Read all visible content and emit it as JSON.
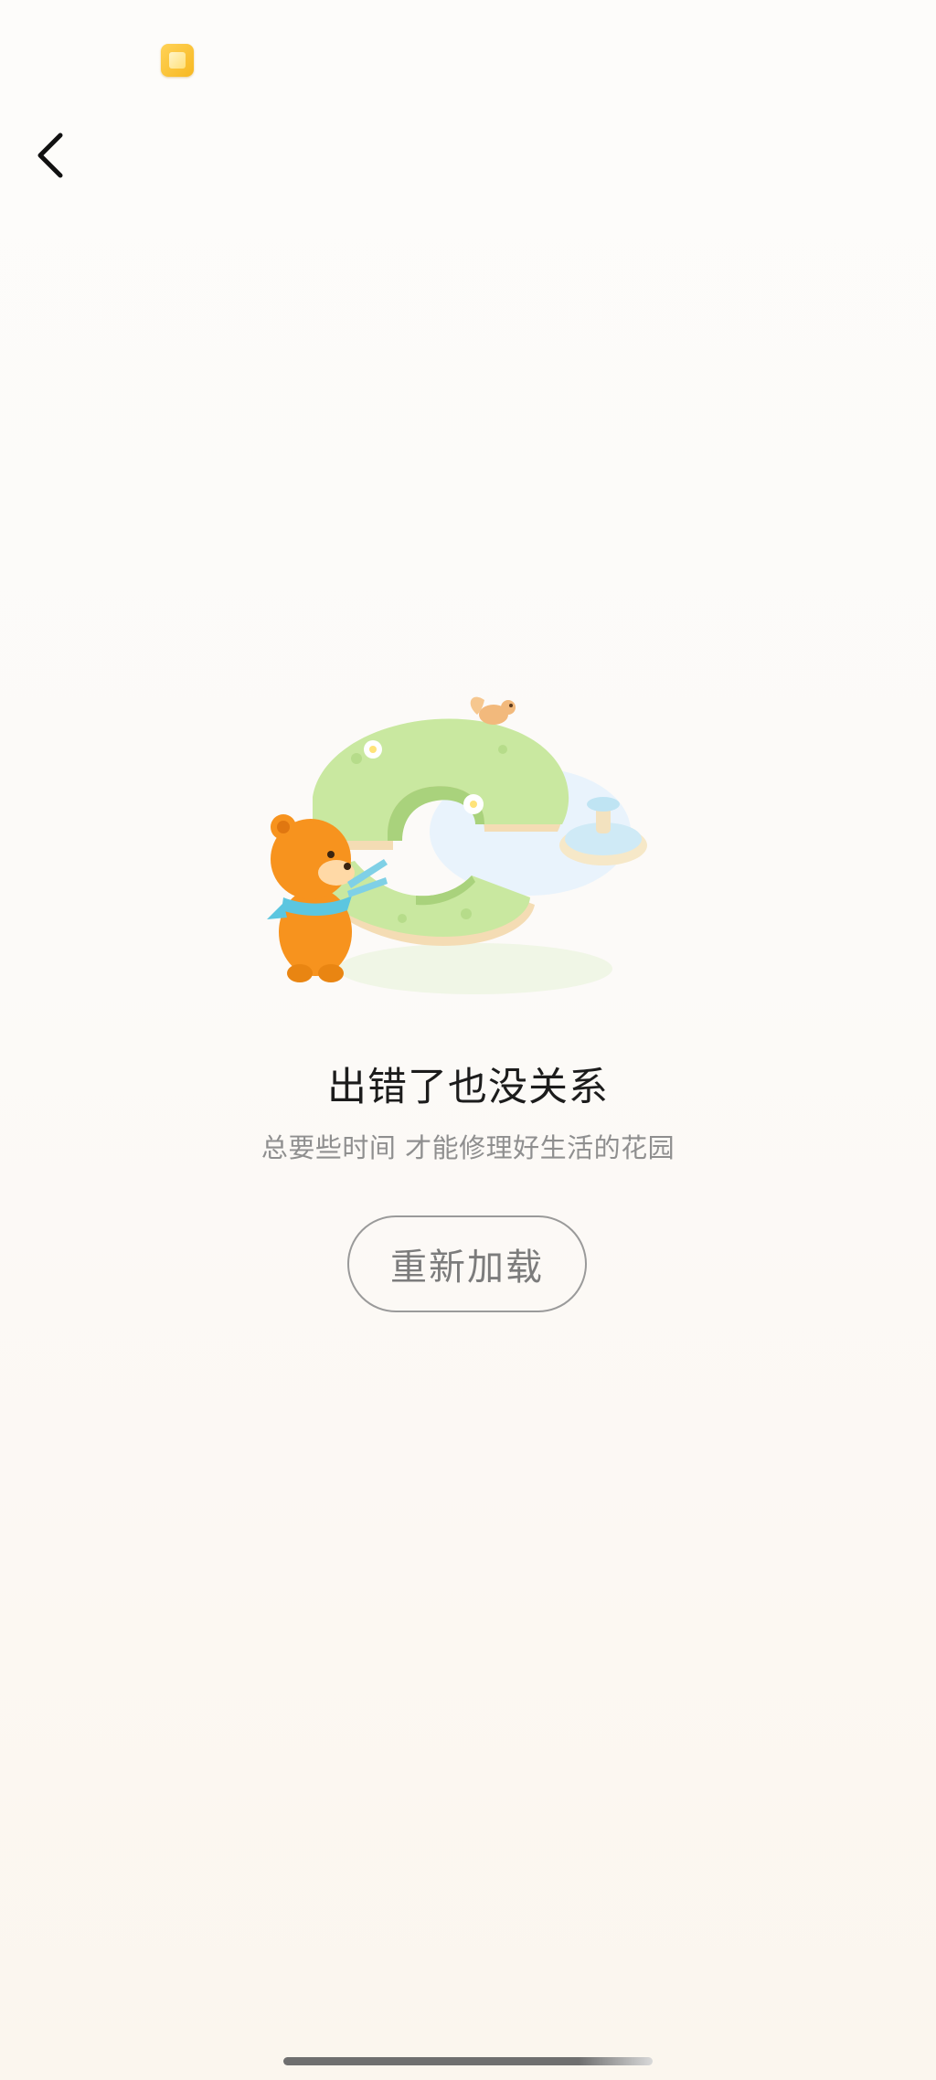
{
  "nav": {
    "back_icon": "chevron-left-icon"
  },
  "status_bar": {
    "app_badge_icon": "yellow-app-badge-icon"
  },
  "illustration": {
    "icon": "garden-repair-illustration",
    "colors": {
      "grass": "#cbe9a6",
      "bear": "#f7941d",
      "water": "#cfe8f5"
    }
  },
  "error": {
    "title": "出错了也没关系",
    "subtitle": "总要些时间 才能修理好生活的花园"
  },
  "actions": {
    "reload_label": "重新加载"
  }
}
